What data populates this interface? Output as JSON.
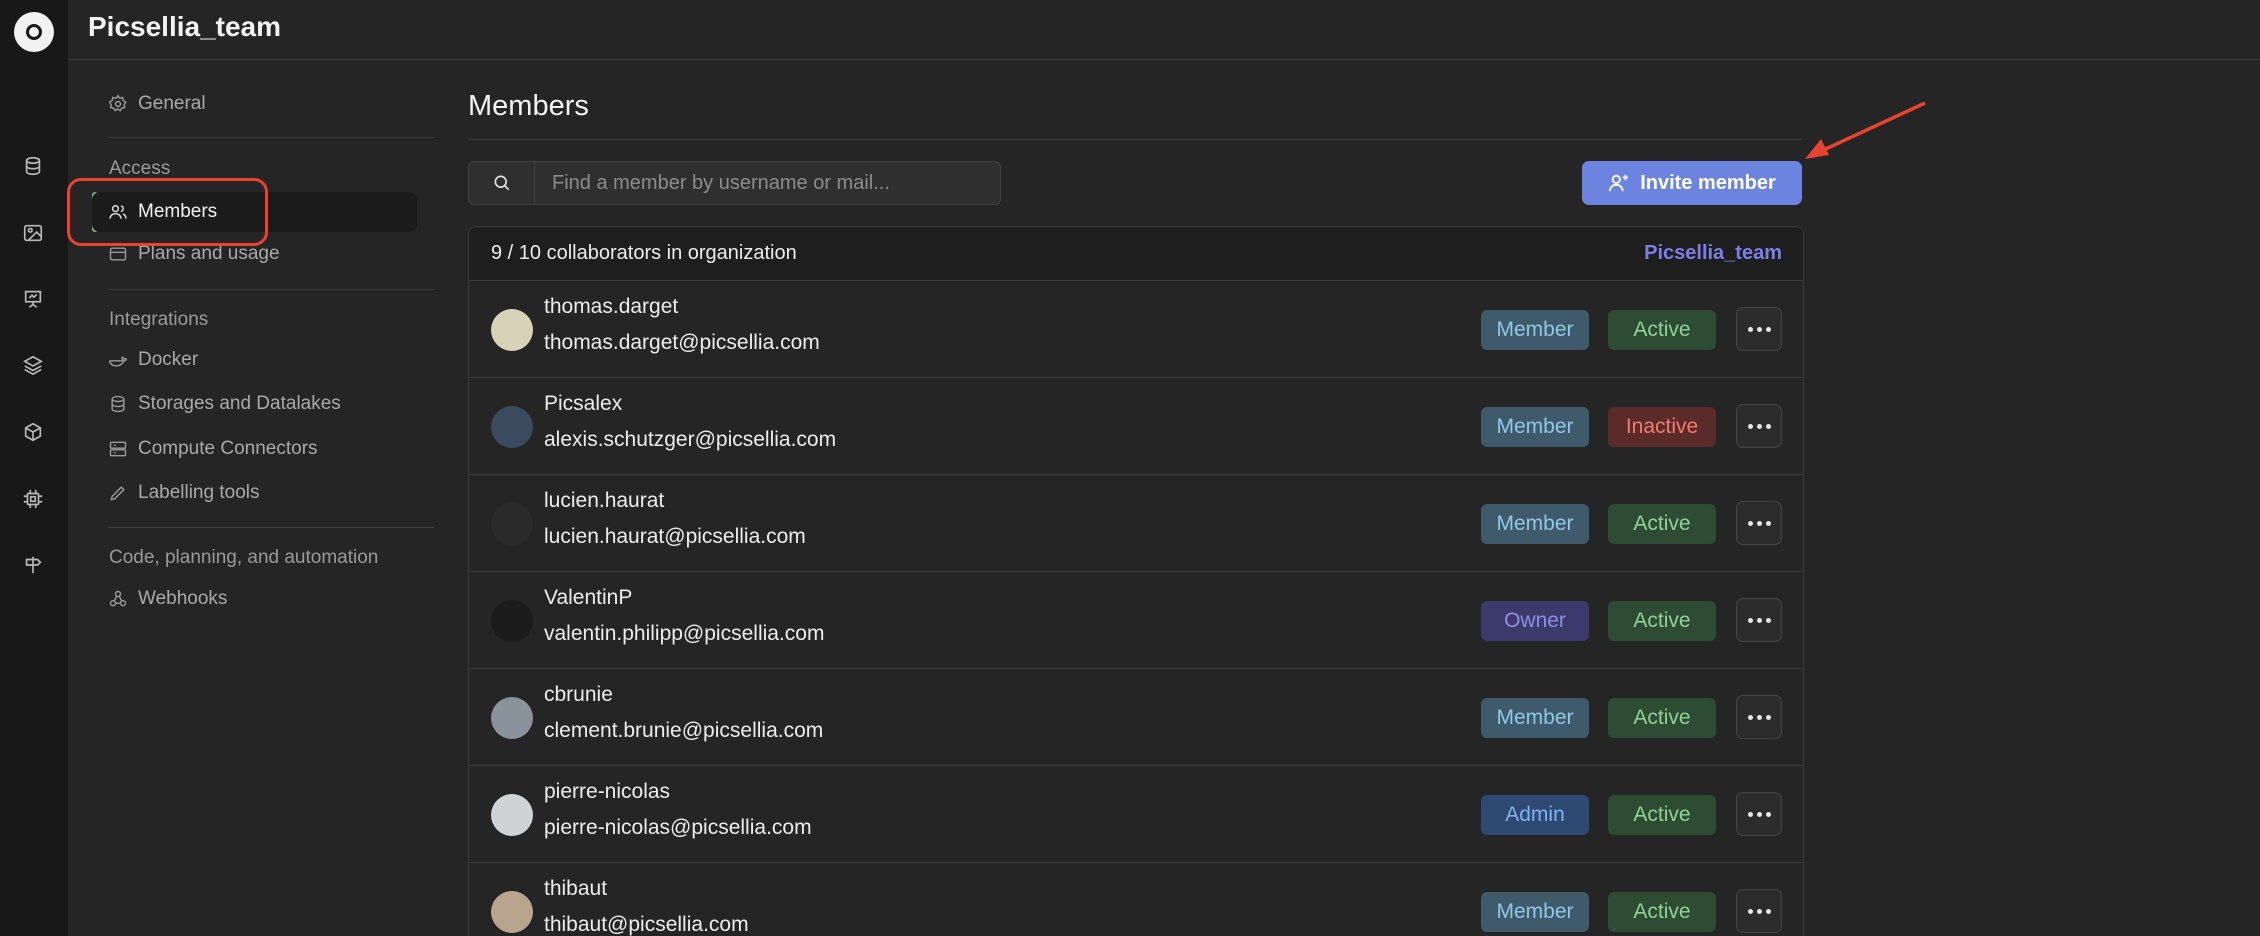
{
  "header": {
    "title": "Picsellia_team"
  },
  "sidebar": {
    "general": "General",
    "sections": {
      "access": "Access",
      "integrations": "Integrations",
      "automation": "Code, planning, and automation"
    },
    "access_items": [
      "Members",
      "Plans and usage"
    ],
    "integration_items": [
      "Docker",
      "Storages and Datalakes",
      "Compute Connectors",
      "Labelling tools"
    ],
    "automation_items": [
      "Webhooks"
    ]
  },
  "main": {
    "title": "Members",
    "search_placeholder": "Find a member by username or mail...",
    "invite_label": "Invite member",
    "collaborators": "9 / 10 collaborators in organization",
    "org_link": "Picsellia_team"
  },
  "members": [
    {
      "username": "thomas.darget",
      "email": "thomas.darget@picsellia.com",
      "role": "Member",
      "status": "Active"
    },
    {
      "username": "Picsalex",
      "email": "alexis.schutzger@picsellia.com",
      "role": "Member",
      "status": "Inactive"
    },
    {
      "username": "lucien.haurat",
      "email": "lucien.haurat@picsellia.com",
      "role": "Member",
      "status": "Active"
    },
    {
      "username": "ValentinP",
      "email": "valentin.philipp@picsellia.com",
      "role": "Owner",
      "status": "Active"
    },
    {
      "username": "cbrunie",
      "email": "clement.brunie@picsellia.com",
      "role": "Member",
      "status": "Active"
    },
    {
      "username": "pierre-nicolas",
      "email": "pierre-nicolas@picsellia.com",
      "role": "Admin",
      "status": "Active"
    },
    {
      "username": "thibaut",
      "email": "thibaut@picsellia.com",
      "role": "Member",
      "status": "Active"
    }
  ],
  "colors": {
    "accent": "#6c83e0",
    "annotation": "#e8432f",
    "active_bar": "#6dbb7a",
    "org_link": "#7b7fe6"
  }
}
